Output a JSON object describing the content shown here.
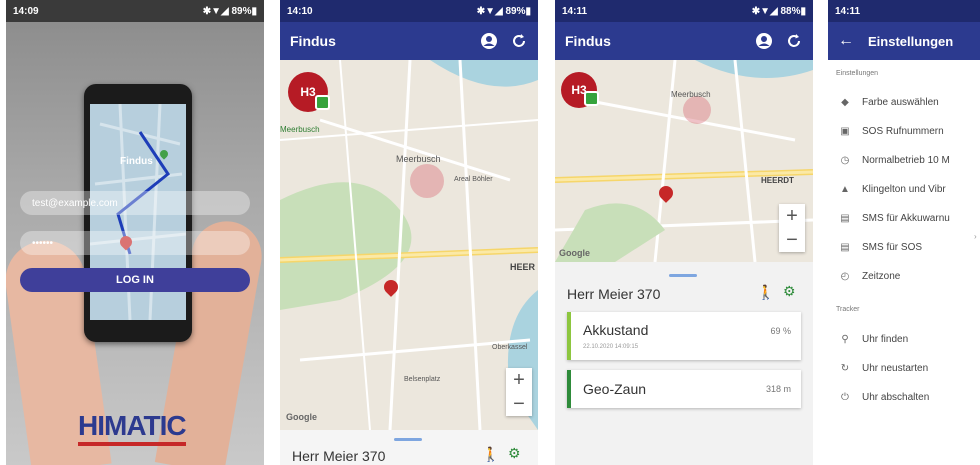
{
  "colors": {
    "primary": "#2c3a8f",
    "status_bar": "#1f2a6e",
    "marker": "#c62828",
    "avatar": "#b61b25",
    "accent_green": "#35a33c",
    "battery_bar": "#8dc63f"
  },
  "screen1": {
    "status": {
      "time": "14:09",
      "indicators": "✱▼◢ 89%▮"
    },
    "app_title_on_phone": "Findus",
    "email_value": "test@example.com",
    "password_value": "••••••",
    "login_label": "LOG IN",
    "brand_logo": "HIMATIC"
  },
  "screen2": {
    "status": {
      "time": "14:10",
      "indicators": "✱▼◢ 89%▮"
    },
    "app_title": "Findus",
    "avatar_label": "H3",
    "map_labels": {
      "meerbusch": "Meerbusch",
      "meerbusch_left": "Meerbusch",
      "areal": "Areal Böhler",
      "heer": "HEER",
      "oberkassel": "Oberkassel",
      "belsenplatz": "Belsenplatz",
      "google": "Google"
    },
    "zoom_in": "+",
    "zoom_out": "−",
    "sheet_title": "Herr Meier 370"
  },
  "screen3": {
    "status": {
      "time": "14:11",
      "indicators": "✱▼◢ 88%▮"
    },
    "app_title": "Findus",
    "avatar_label": "H3",
    "map_labels": {
      "meerbusch": "Meerbusch",
      "heerdt": "HEERDT",
      "google": "Google"
    },
    "zoom_in": "+",
    "zoom_out": "−",
    "sheet_title": "Herr Meier 370",
    "cards": [
      {
        "label": "Akkustand",
        "value": "69 %",
        "sub": "22.10.2020 14:09:15"
      },
      {
        "label": "Geo-Zaun",
        "value": "318 m"
      }
    ]
  },
  "screen4": {
    "status": {
      "time": "14:11"
    },
    "title": "Einstellungen",
    "section_settings": "Einstellungen",
    "settings": [
      {
        "icon": "palette-icon",
        "label": "Farbe auswählen"
      },
      {
        "icon": "sos-icon",
        "label": "SOS Rufnummern"
      },
      {
        "icon": "clock-icon",
        "label": "Normalbetrieb 10 M"
      },
      {
        "icon": "bell-icon",
        "label": "Klingelton und Vibr"
      },
      {
        "icon": "sms-icon",
        "label": "SMS für Akkuwarnu"
      },
      {
        "icon": "sms-icon",
        "label": "SMS für SOS"
      },
      {
        "icon": "timezone-icon",
        "label": "Zeitzone"
      }
    ],
    "section_tracker": "Tracker",
    "tracker": [
      {
        "icon": "search-icon",
        "label": "Uhr finden"
      },
      {
        "icon": "restart-icon",
        "label": "Uhr neustarten"
      },
      {
        "icon": "power-icon",
        "label": "Uhr abschalten"
      }
    ]
  }
}
